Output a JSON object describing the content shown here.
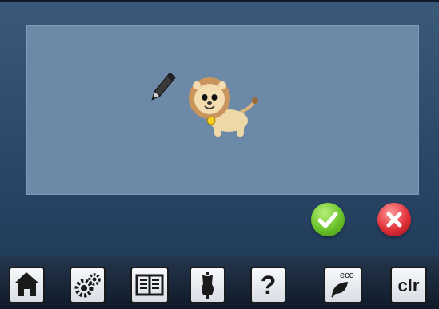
{
  "preview": {
    "pencil_icon": "pencil-icon",
    "image_icon": "lion-icon"
  },
  "actions": {
    "confirm_icon": "checkmark-icon",
    "cancel_icon": "x-icon",
    "confirm_color": "#6cc22b",
    "cancel_color": "#e0313a"
  },
  "toolbar": {
    "home_icon": "home-icon",
    "settings_icon": "gears-icon",
    "tutorial_icon": "book-icon",
    "advisor_icon": "dress-form-icon",
    "help_label": "?",
    "eco_label": "eco",
    "clr_label": "clr"
  },
  "colors": {
    "screen_bg": "#2f4c6d",
    "preview_bg": "#6d89a8",
    "toolbar_bg": "#101a28"
  }
}
